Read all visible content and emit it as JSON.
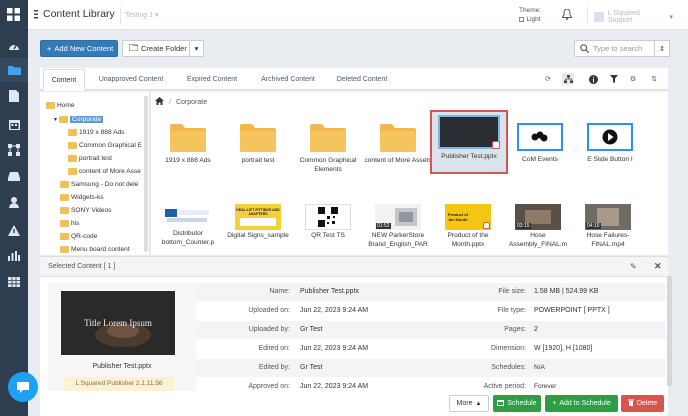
{
  "app": {
    "title": "Content Library",
    "env_label": "Testing 1"
  },
  "topbar": {
    "theme_label": "Theme:",
    "theme_value": "Light",
    "user_name": "L Squared Support"
  },
  "toolbar": {
    "add_new": "Add New Content",
    "create_folder": "Create Folder",
    "search_placeholder": "Type to search"
  },
  "tabs": [
    {
      "label": "Content"
    },
    {
      "label": "Unapproved Content"
    },
    {
      "label": "Expired Content"
    },
    {
      "label": "Archived Content"
    },
    {
      "label": "Deleted Content"
    }
  ],
  "tree": {
    "home": "Home",
    "corporate": "Corporate",
    "children": [
      "1919 x 888 Ads",
      "Common Graphical E",
      "portrait test",
      "content of More Asse"
    ],
    "siblings": [
      "Samsung - Do not dele",
      "Widgets-ks",
      "SONY Videos",
      "his",
      "QR-code",
      "Menu board content"
    ]
  },
  "breadcrumb": {
    "current": "Corporate"
  },
  "tiles_row1": [
    {
      "label": "1919 x 888 Ads"
    },
    {
      "label": "portrait test"
    },
    {
      "label": "Common Graphical Elements"
    },
    {
      "label": "content of More Assets"
    },
    {
      "label": "Publisher Test.pptx"
    },
    {
      "label": "CoM Events"
    },
    {
      "label": "E Slide Button I"
    }
  ],
  "tiles_row2": [
    {
      "label": "Distributor bottom_Counter.p"
    },
    {
      "label": "Digital Signs_sample"
    },
    {
      "label": "QR Test TS"
    },
    {
      "label": "NEW ParkerStore Brand_English_PAR"
    },
    {
      "label": "Product of the Month.pptx"
    },
    {
      "label": "Hose Assembly_FINAL.m"
    },
    {
      "label": "Hose Failures-FINAL.mp4"
    }
  ],
  "thumb_texts": {
    "sales_text": "DEAL-LIFT FITTINGS AND ADAPTERS",
    "product_title": "Product of the Month",
    "video_times": [
      "01:52",
      "03:15",
      "04:15"
    ]
  },
  "selected": {
    "header": "Selected Content [ 1 ]",
    "preview_text": "Title Lorem Ipsum",
    "preview_name": "Publisher Test.pptx",
    "publisher": "L Squared Publisher 2.1.11.56"
  },
  "props_left": [
    {
      "k": "Name:",
      "v": "Publisher Test.pptx"
    },
    {
      "k": "Uploaded on:",
      "v": "Jun 22, 2023 9:24 AM"
    },
    {
      "k": "Uploaded by:",
      "v": "Gr Test"
    },
    {
      "k": "Edited on:",
      "v": "Jun 22, 2023 9:24 AM"
    },
    {
      "k": "Edited by:",
      "v": "Gr Test"
    },
    {
      "k": "Approved on:",
      "v": "Jun 22, 2023 9:24 AM"
    }
  ],
  "props_right": [
    {
      "k": "File size:",
      "v": "1.58 MB | 524.99 KB"
    },
    {
      "k": "File type:",
      "v": "POWERPOINT [ PPTX ]"
    },
    {
      "k": "Pages:",
      "v": "2"
    },
    {
      "k": "Dimension:",
      "v": "W [1920], H [1080]"
    },
    {
      "k": "Schedules:",
      "v": "N/A"
    },
    {
      "k": "Active period:",
      "v": "Forever"
    }
  ],
  "footer": {
    "more": "More",
    "schedule": "Schedule",
    "add_to_schedule": "Add to Schedule",
    "delete": "Delete"
  },
  "colors": {
    "sidebar": "#2c3e50",
    "primary": "#337ab7",
    "success": "#2e9e44",
    "danger": "#d9534f",
    "folder": "#f2b84b"
  }
}
